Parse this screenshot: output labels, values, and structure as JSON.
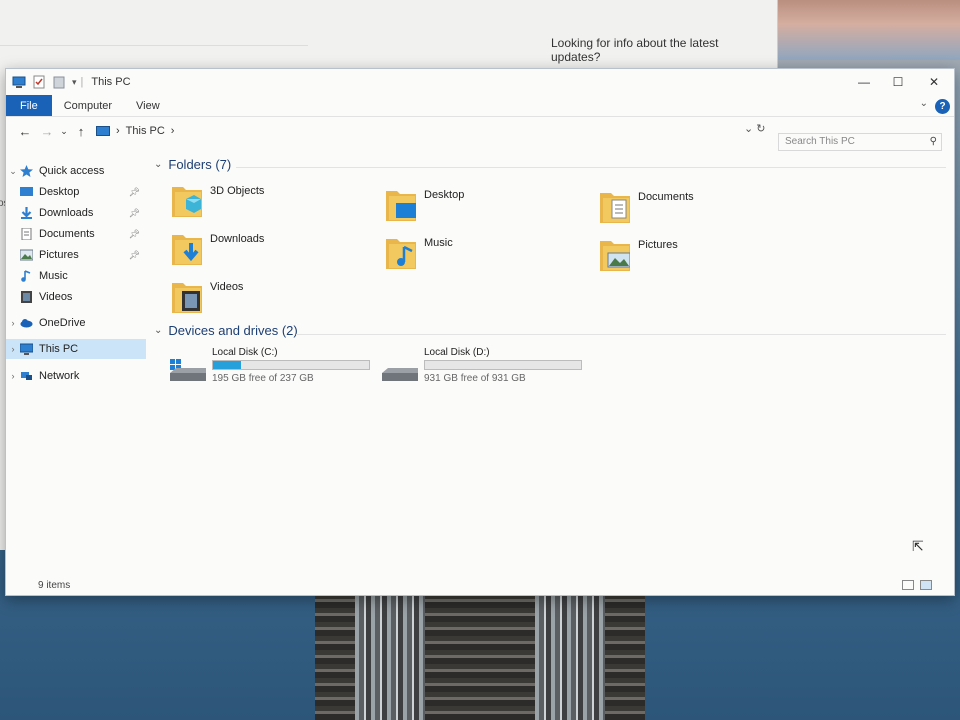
{
  "background_window": {
    "updates_text": "Looking for info about the latest updates?",
    "side_text": "os"
  },
  "window": {
    "title": "This PC",
    "controls": {
      "minimize": "—",
      "maximize": "☐",
      "close": "✕"
    }
  },
  "ribbon": {
    "tabs": [
      {
        "label": "File",
        "active": true
      },
      {
        "label": "Computer",
        "active": false
      },
      {
        "label": "View",
        "active": false
      }
    ],
    "help": "?"
  },
  "address": {
    "path": "This PC",
    "separator": "›",
    "search_placeholder": "Search This PC"
  },
  "nav_pane": {
    "items": [
      {
        "label": "Quick access",
        "chevron": "v",
        "icon": "star-icon",
        "pinned": false
      },
      {
        "label": "Desktop",
        "chevron": "",
        "icon": "desktop-icon",
        "pinned": true
      },
      {
        "label": "Downloads",
        "chevron": "",
        "icon": "downloads-icon",
        "pinned": true
      },
      {
        "label": "Documents",
        "chevron": "",
        "icon": "documents-icon",
        "pinned": true
      },
      {
        "label": "Pictures",
        "chevron": "",
        "icon": "pictures-icon",
        "pinned": true
      },
      {
        "label": "Music",
        "chevron": "",
        "icon": "music-icon",
        "pinned": false
      },
      {
        "label": "Videos",
        "chevron": "",
        "icon": "videos-icon",
        "pinned": false
      },
      {
        "label": "OneDrive",
        "chevron": ">",
        "icon": "onedrive-icon",
        "pinned": false
      },
      {
        "label": "This PC",
        "chevron": ">",
        "icon": "this-pc-icon",
        "pinned": false,
        "selected": true
      },
      {
        "label": "Network",
        "chevron": ">",
        "icon": "network-icon",
        "pinned": false
      }
    ]
  },
  "folders_group": {
    "header": "Folders (7)",
    "items": [
      {
        "label": "3D Objects",
        "icon": "3d-objects-icon"
      },
      {
        "label": "Desktop",
        "icon": "desktop-folder-icon"
      },
      {
        "label": "Documents",
        "icon": "documents-folder-icon"
      },
      {
        "label": "Downloads",
        "icon": "downloads-folder-icon"
      },
      {
        "label": "Music",
        "icon": "music-folder-icon"
      },
      {
        "label": "Pictures",
        "icon": "pictures-folder-icon"
      },
      {
        "label": "Videos",
        "icon": "videos-folder-icon"
      }
    ]
  },
  "drives_group": {
    "header": "Devices and drives (2)",
    "items": [
      {
        "label": "Local Disk (C:)",
        "free_text": "195 GB free of 237 GB",
        "used_fraction": 0.18
      },
      {
        "label": "Local Disk (D:)",
        "free_text": "931 GB free of 931 GB",
        "used_fraction": 0.0
      }
    ]
  },
  "status": {
    "items_count": "9 items"
  },
  "colors": {
    "accent": "#1a62b7",
    "drive_bar": "#26a0da",
    "folder": "#e8b64a"
  }
}
